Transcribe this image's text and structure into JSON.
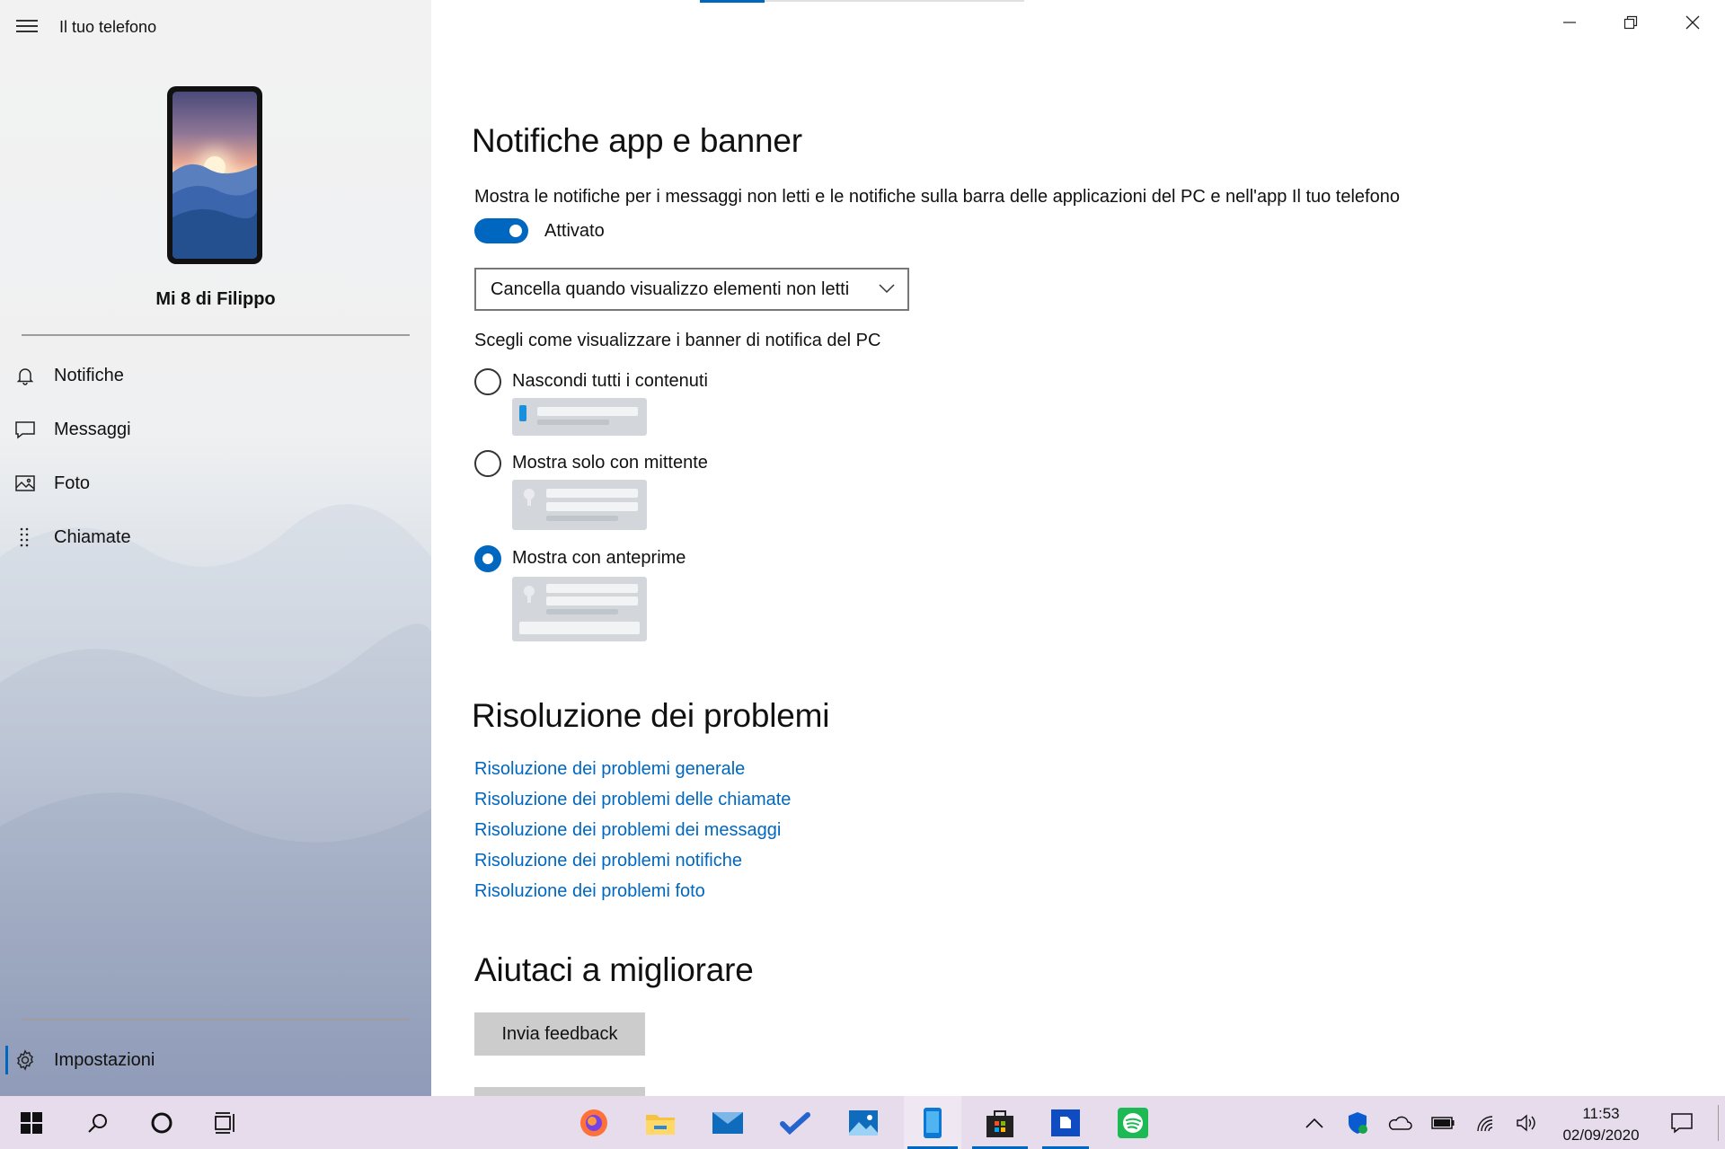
{
  "app": {
    "title": "Il tuo telefono"
  },
  "device": {
    "name": "Mi 8 di Filippo"
  },
  "nav": {
    "items": [
      {
        "label": "Notifiche",
        "icon": "bell-icon"
      },
      {
        "label": "Messaggi",
        "icon": "message-icon"
      },
      {
        "label": "Foto",
        "icon": "photo-icon"
      },
      {
        "label": "Chiamate",
        "icon": "dialpad-icon"
      }
    ],
    "settings": {
      "label": "Impostazioni",
      "icon": "gear-icon"
    }
  },
  "notifications": {
    "heading": "Notifiche app e banner",
    "description": "Mostra le notifiche per i messaggi non letti e le notifiche sulla barra delle applicazioni del PC e nell'app Il tuo telefono",
    "toggle_label": "Attivato",
    "toggle_on": true,
    "dropdown_value": "Cancella quando visualizzo elementi non letti",
    "banner_label": "Scegli come visualizzare i banner di notifica del PC",
    "options": [
      {
        "label": "Nascondi tutti i contenuti",
        "checked": false
      },
      {
        "label": "Mostra solo con mittente",
        "checked": false
      },
      {
        "label": "Mostra con anteprime",
        "checked": true
      }
    ]
  },
  "troubleshooting": {
    "heading": "Risoluzione dei problemi",
    "links": [
      "Risoluzione dei problemi generale",
      "Risoluzione dei problemi delle chiamate",
      "Risoluzione dei problemi dei messaggi",
      "Risoluzione dei problemi notifiche",
      "Risoluzione dei problemi foto"
    ]
  },
  "feedback": {
    "heading": "Aiutaci a migliorare",
    "button": "Invia feedback"
  },
  "colors": {
    "accent": "#0067c0",
    "taskbar": "#e6dcec",
    "link": "#0067c0"
  },
  "taskbar": {
    "time": "11:53",
    "date": "02/09/2020",
    "apps": [
      "firefox-icon",
      "file-explorer-icon",
      "mail-icon",
      "todo-icon",
      "photos-icon",
      "your-phone-icon",
      "store-icon",
      "whiteboard-icon",
      "spotify-icon"
    ]
  }
}
